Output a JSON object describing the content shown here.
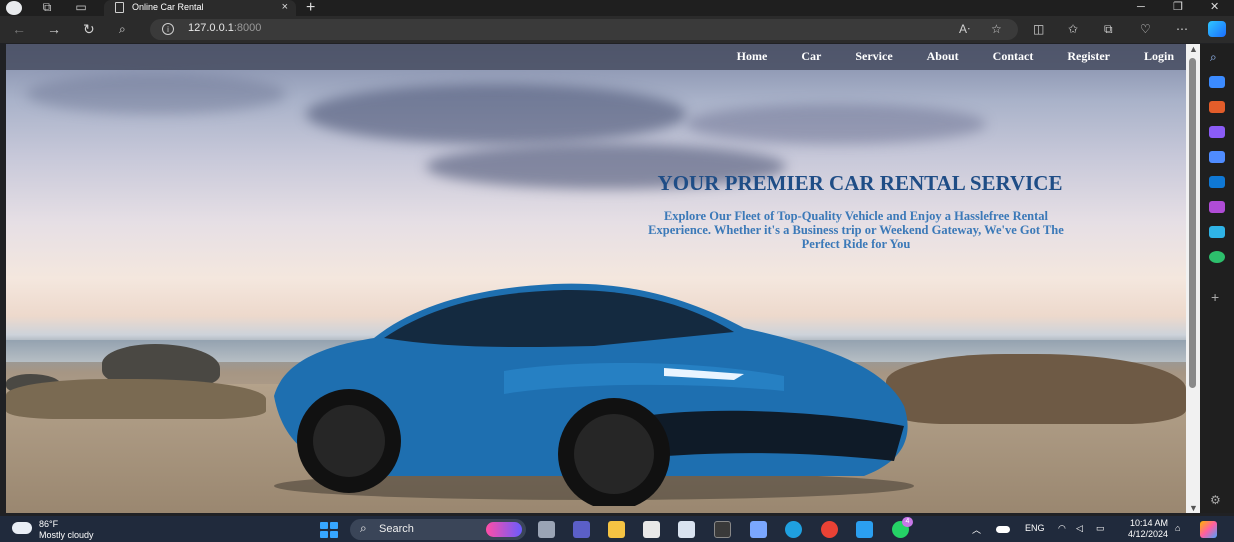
{
  "browser": {
    "tab_title": "Online Car Rental",
    "url_host": "127.0.0.1",
    "url_port": ":8000",
    "new_tab": "+",
    "close_tab": "×"
  },
  "site": {
    "nav": [
      "Home",
      "Car",
      "Service",
      "About",
      "Contact",
      "Register",
      "Login"
    ],
    "hero_title": "YOUR PREMIER CAR RENTAL SERVICE",
    "hero_subtitle": "Explore Our Fleet of Top-Quality Vehicle and Enjoy a Hasslefree Rental Experience. Whether it's a Business trip or Weekend Gateway, We've Got The Perfect Ride for You"
  },
  "taskbar": {
    "weather_temp": "86°F",
    "weather_desc": "Mostly cloudy",
    "search_label": "Search",
    "lang": "ENG",
    "time": "10:14 AM",
    "date": "4/12/2024",
    "whatsapp_badge": "4"
  },
  "colors": {
    "hero_title": "#1f4d86",
    "hero_subtitle": "#3b79b8",
    "car_body": "#1e6fb0"
  }
}
